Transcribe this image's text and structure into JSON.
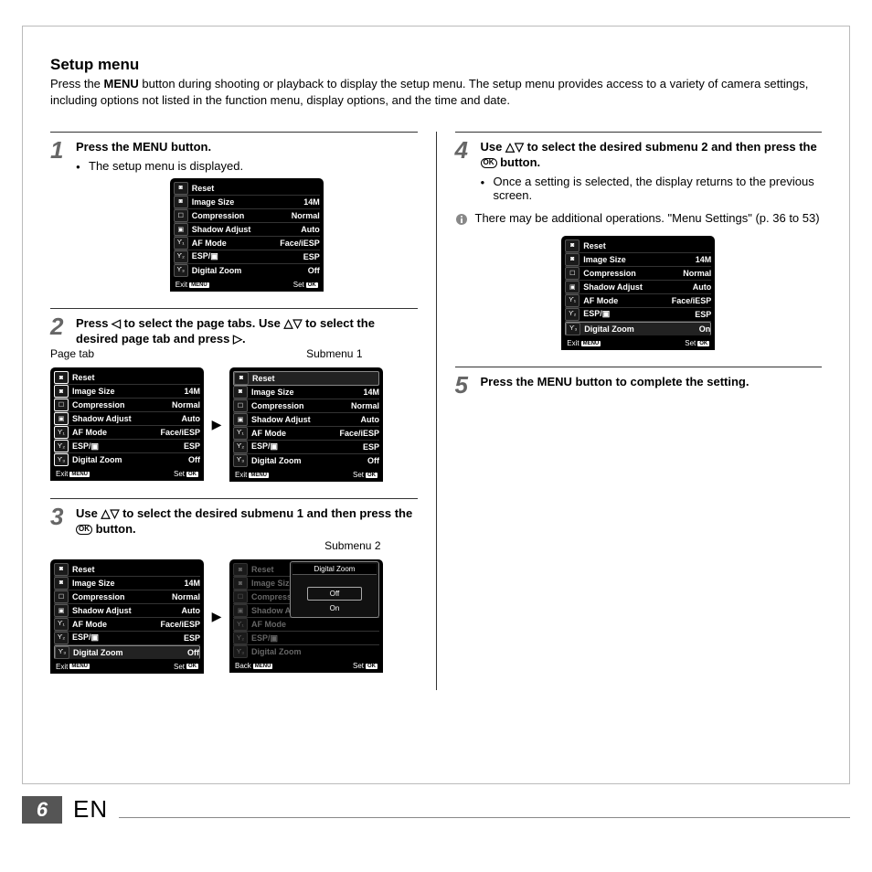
{
  "page": {
    "title": "Setup menu",
    "intro_pre": "Press the ",
    "intro_bold": "MENU",
    "intro_post": " button during shooting or playback to display the setup menu. The setup menu provides access to a variety of camera settings, including options not listed in the function menu, display options, and the time and date."
  },
  "labels": {
    "page_tab": "Page tab",
    "submenu1": "Submenu 1",
    "submenu2": "Submenu 2"
  },
  "steps": {
    "s1": {
      "num": "1",
      "head_pre": "Press the ",
      "head_bold": "MENU",
      "head_post": " button.",
      "bullet": "The setup menu is displayed."
    },
    "s2": {
      "num": "2",
      "head": "Press ◁ to select the page tabs. Use △▽ to select the desired page tab and press ▷."
    },
    "s3": {
      "num": "3",
      "head_pre": "Use △▽ to select the desired submenu 1 and then press the ",
      "head_post": " button."
    },
    "s4": {
      "num": "4",
      "head_pre": "Use △▽ to select the desired submenu 2 and then press the ",
      "head_post": " button.",
      "bullet": "Once a setting is selected, the display returns to the previous screen."
    },
    "note": "There may be additional operations. \"Menu Settings\" (p. 36 to 53)",
    "s5": {
      "num": "5",
      "head_pre": "Press the ",
      "head_bold": "MENU",
      "head_post": " button to complete the setting."
    }
  },
  "menu_rows": {
    "reset": "Reset",
    "image_size": "Image Size",
    "compression": "Compression",
    "shadow_adjust": "Shadow Adjust",
    "af_mode": "AF Mode",
    "esp": "ESP/▣",
    "digital_zoom": "Digital Zoom"
  },
  "vals": {
    "image_size": "14M",
    "compression": "Normal",
    "shadow_adjust": "Auto",
    "af_mode": "Face/iESP",
    "esp": "ESP",
    "dz_off": "Off",
    "dz_on": "On"
  },
  "footer": {
    "exit": "Exit",
    "back": "Back",
    "set": "Set",
    "menu_btn": "MENU",
    "ok_btn": "OK"
  },
  "popup": {
    "title": "Digital Zoom",
    "off": "Off",
    "on": "On"
  },
  "pagefoot": {
    "num": "6",
    "lang": "EN"
  },
  "ok_label": "OK"
}
